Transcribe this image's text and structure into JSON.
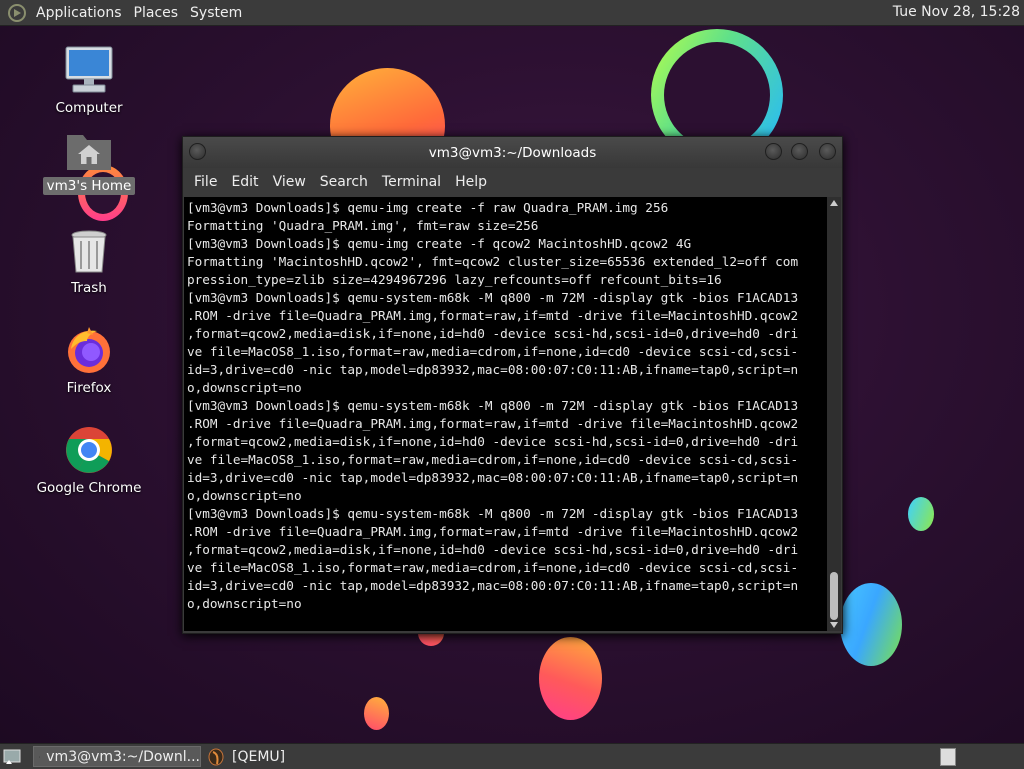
{
  "top_panel": {
    "menus": [
      "Applications",
      "Places",
      "System"
    ],
    "clock": "Tue Nov 28, 15:28"
  },
  "desktop_icons": [
    {
      "label": "Computer",
      "icon": "computer-icon"
    },
    {
      "label": "vm3's Home",
      "icon": "home-folder-icon"
    },
    {
      "label": "Trash",
      "icon": "trash-icon"
    },
    {
      "label": "Firefox",
      "icon": "firefox-icon"
    },
    {
      "label": "Google Chrome",
      "icon": "chrome-icon"
    }
  ],
  "window": {
    "title": "vm3@vm3:~/Downloads",
    "menus": [
      "File",
      "Edit",
      "View",
      "Search",
      "Terminal",
      "Help"
    ],
    "terminal_lines": [
      "[vm3@vm3 Downloads]$ qemu-img create -f raw Quadra_PRAM.img 256",
      "Formatting 'Quadra_PRAM.img', fmt=raw size=256",
      "[vm3@vm3 Downloads]$ qemu-img create -f qcow2 MacintoshHD.qcow2 4G",
      "Formatting 'MacintoshHD.qcow2', fmt=qcow2 cluster_size=65536 extended_l2=off com",
      "pression_type=zlib size=4294967296 lazy_refcounts=off refcount_bits=16",
      "[vm3@vm3 Downloads]$ qemu-system-m68k -M q800 -m 72M -display gtk -bios F1ACAD13",
      ".ROM -drive file=Quadra_PRAM.img,format=raw,if=mtd -drive file=MacintoshHD.qcow2",
      ",format=qcow2,media=disk,if=none,id=hd0 -device scsi-hd,scsi-id=0,drive=hd0 -dri",
      "ve file=MacOS8_1.iso,format=raw,media=cdrom,if=none,id=cd0 -device scsi-cd,scsi-",
      "id=3,drive=cd0 -nic tap,model=dp83932,mac=08:00:07:C0:11:AB,ifname=tap0,script=n",
      "o,downscript=no",
      "[vm3@vm3 Downloads]$ qemu-system-m68k -M q800 -m 72M -display gtk -bios F1ACAD13",
      ".ROM -drive file=Quadra_PRAM.img,format=raw,if=mtd -drive file=MacintoshHD.qcow2",
      ",format=qcow2,media=disk,if=none,id=hd0 -device scsi-hd,scsi-id=0,drive=hd0 -dri",
      "ve file=MacOS8_1.iso,format=raw,media=cdrom,if=none,id=cd0 -device scsi-cd,scsi-",
      "id=3,drive=cd0 -nic tap,model=dp83932,mac=08:00:07:C0:11:AB,ifname=tap0,script=n",
      "o,downscript=no",
      "[vm3@vm3 Downloads]$ qemu-system-m68k -M q800 -m 72M -display gtk -bios F1ACAD13",
      ".ROM -drive file=Quadra_PRAM.img,format=raw,if=mtd -drive file=MacintoshHD.qcow2",
      ",format=qcow2,media=disk,if=none,id=hd0 -device scsi-hd,scsi-id=0,drive=hd0 -dri",
      "ve file=MacOS8_1.iso,format=raw,media=cdrom,if=none,id=cd0 -device scsi-cd,scsi-",
      "id=3,drive=cd0 -nic tap,model=dp83932,mac=08:00:07:C0:11:AB,ifname=tap0,script=n",
      "o,downscript=no"
    ]
  },
  "taskbar": {
    "tasks": [
      {
        "label": "vm3@vm3:~/Downl...",
        "icon": "terminal-icon"
      },
      {
        "label": "[QEMU]",
        "icon": "qemu-icon"
      }
    ]
  }
}
